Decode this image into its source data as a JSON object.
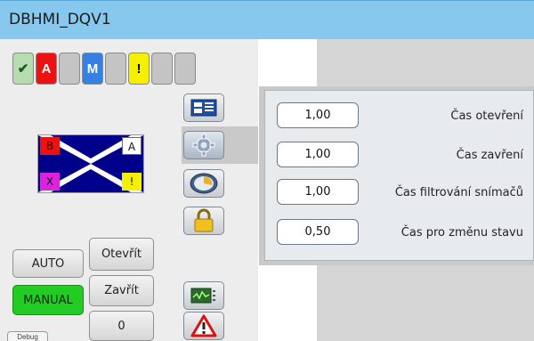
{
  "window": {
    "title": "DBHMI_DQV1"
  },
  "status": [
    "✔",
    "A",
    "",
    "M",
    "",
    "!",
    "",
    ""
  ],
  "valve": {
    "b": "B",
    "a": "A",
    "x": "X",
    "y": "!"
  },
  "mode_buttons": {
    "auto": "AUTO",
    "manual": "MANUAL"
  },
  "command_buttons": {
    "open": "Otevřít",
    "close": "Zavřít",
    "zero": "0"
  },
  "debug": "Debug",
  "parameters": [
    {
      "value": "1,00",
      "label": "Čas otevření"
    },
    {
      "value": "1,00",
      "label": "Čas zavření"
    },
    {
      "value": "1,00",
      "label": "Čas filtrování snímačů"
    },
    {
      "value": "0,50",
      "label": "Čas pro změnu stavu"
    }
  ],
  "tabs": [
    "list-icon",
    "settings-gear-icon",
    "trend-dial-icon",
    "lock-icon",
    "chart-monitor-icon",
    "alarm-warning-icon"
  ],
  "colors": {
    "titlebar": "#87c8ee",
    "manual_active": "#22cc22",
    "status_red": "#ee1111",
    "status_blue": "#3580e4",
    "status_yellow": "#f5f000"
  }
}
